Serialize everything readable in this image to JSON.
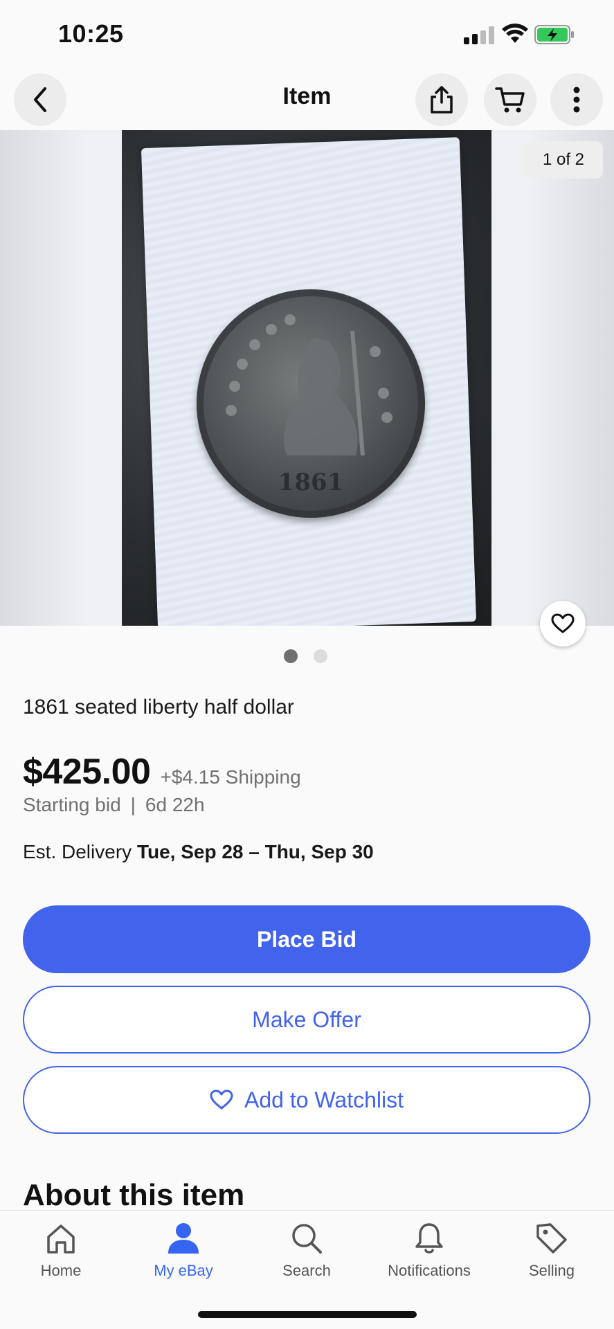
{
  "status": {
    "time": "10:25"
  },
  "nav": {
    "title": "Item"
  },
  "photo": {
    "counter": "1 of 2",
    "current_index": 1,
    "total": 2
  },
  "item": {
    "title": "1861 seated liberty half dollar",
    "price": "$425.00",
    "shipping": "+$4.15 Shipping",
    "bid_type": "Starting bid",
    "separator": "|",
    "time_left": "6d 22h",
    "delivery_label": "Est. Delivery",
    "delivery_dates": "Tue, Sep 28 – Thu, Sep 30"
  },
  "actions": {
    "place_bid": "Place Bid",
    "make_offer": "Make Offer",
    "add_watchlist": "Add to Watchlist"
  },
  "section": {
    "about": "About this item"
  },
  "tabbar": {
    "items": [
      {
        "label": "Home",
        "icon": "home-icon"
      },
      {
        "label": "My eBay",
        "icon": "person-icon",
        "active": true
      },
      {
        "label": "Search",
        "icon": "search-icon"
      },
      {
        "label": "Notifications",
        "icon": "bell-icon"
      },
      {
        "label": "Selling",
        "icon": "tag-icon"
      }
    ]
  },
  "colors": {
    "accent": "#4263eb",
    "tab_active": "#3665f3"
  }
}
